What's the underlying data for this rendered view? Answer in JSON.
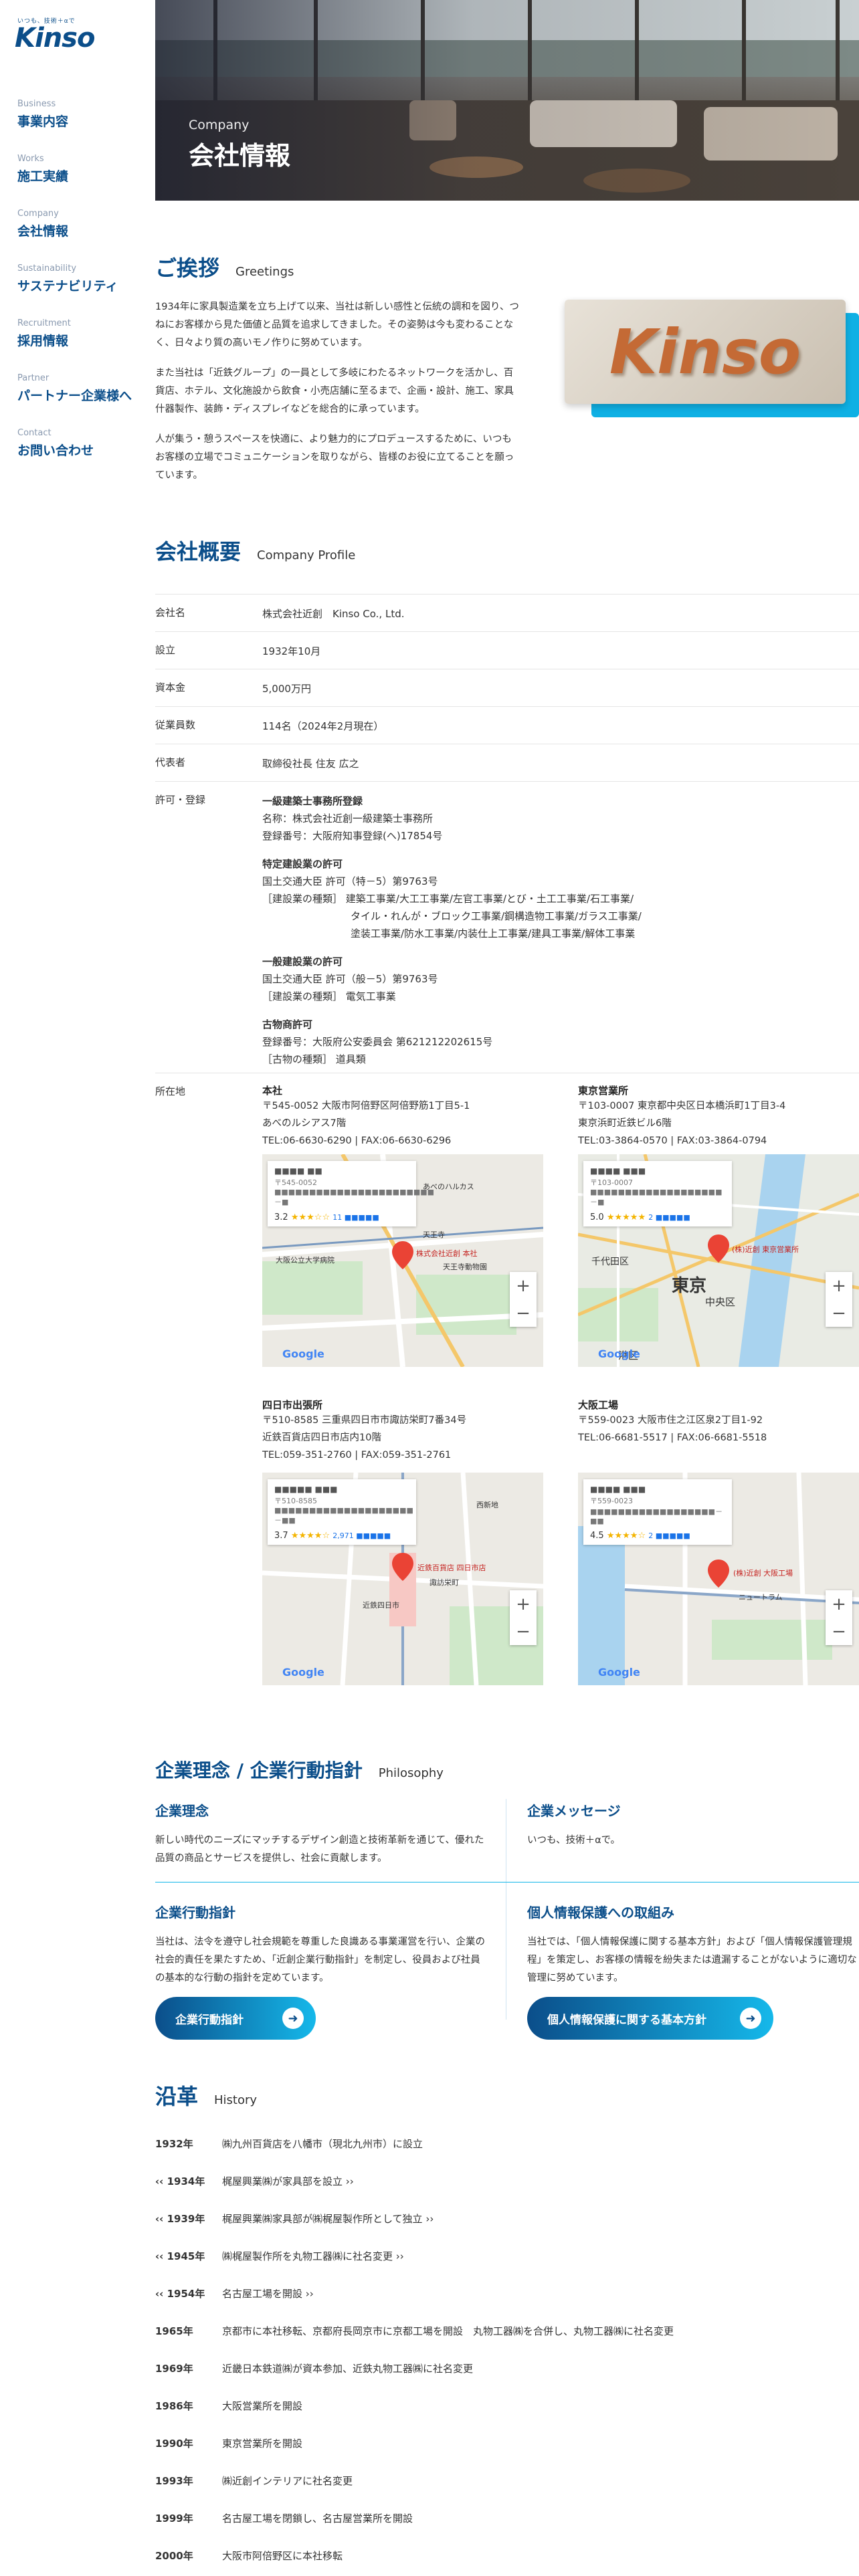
{
  "brand": {
    "tagline": "いつも、技術＋αで",
    "logo_text": "Kinso"
  },
  "nav": [
    {
      "en": "Business",
      "jp": "事業内容"
    },
    {
      "en": "Works",
      "jp": "施工実績"
    },
    {
      "en": "Company",
      "jp": "会社情報"
    },
    {
      "en": "Sustainability",
      "jp": "サステナビリティ"
    },
    {
      "en": "Recruitment",
      "jp": "採用情報"
    },
    {
      "en": "Partner",
      "jp": "パートナー企業様へ"
    },
    {
      "en": "Contact",
      "jp": "お問い合わせ"
    }
  ],
  "hero": {
    "en": "Company",
    "jp": "会社情報"
  },
  "greetings": {
    "jp": "ご挨拶",
    "en": "Greetings",
    "paragraphs": [
      "1934年に家具製造業を立ち上げて以来、当社は新しい感性と伝統の調和を図り、つねにお客様から見た価値と品質を追求してきました。その姿勢は今も変わることなく、日々より質の高いモノ作りに努めています。",
      "また当社は「近鉄グループ」の一員として多岐にわたるネットワークを活かし、百貨店、ホテル、文化施設から飲食・小売店舗に至るまで、企画・設計、施工、家具什器製作、装飾・ディスプレイなどを総合的に承っています。",
      "人が集う・憩うスペースを快適に、より魅力的にプロデュースするために、いつもお客様の立場でコミュニケーションを取りながら、皆様のお役に立てることを願っています。"
    ],
    "sign_text": "Kinso"
  },
  "profile": {
    "jp": "会社概要",
    "en": "Company Profile",
    "rows": [
      {
        "k": "会社名",
        "v": "株式会社近創　Kinso Co., Ltd."
      },
      {
        "k": "設立",
        "v": "1932年10月"
      },
      {
        "k": "資本金",
        "v": "5,000万円"
      },
      {
        "k": "従業員数",
        "v": "114名（2024年2月現在）"
      },
      {
        "k": "代表者",
        "v": "取締役社長 住友 広之"
      }
    ],
    "license_label": "許可・登録",
    "licenses": [
      {
        "h": "一級建築士事務所登録",
        "lines": [
          "名称：株式会社近創一級建築士事務所",
          "登録番号：大阪府知事登録(ヘ)17854号"
        ]
      },
      {
        "h": "特定建設業の許可",
        "lines": [
          "国土交通大臣 許可（特－5）第9763号",
          "［建設業の種類］ 建築工事業/大工工事業/左官工事業/とび・土工工事業/石工事業/",
          "タイル・れんが・ブロック工事業/鋼構造物工事業/ガラス工事業/",
          "塗装工事業/防水工事業/内装仕上工事業/建具工事業/解体工事業"
        ]
      },
      {
        "h": "一般建設業の許可",
        "lines": [
          "国土交通大臣 許可（般－5）第9763号",
          "［建設業の種類］ 電気工事業"
        ]
      },
      {
        "h": "古物商許可",
        "lines": [
          "登録番号：大阪府公安委員会 第621212202615号",
          "［古物の種類］ 道具類"
        ]
      }
    ],
    "location_label": "所在地",
    "offices": [
      {
        "name": "本社",
        "lines": [
          "〒545-0052 大阪市阿倍野区阿倍野筋1丁目5-1",
          "あべのルシアス7階",
          "TEL:06-6630-6290 | FAX:06-6630-6296"
        ],
        "card_title": "■■■■ ■■",
        "card_addr": "〒545-0052 ■■■■■■■■■■■■■■■■■■■■■■■－■",
        "rating": "3.2",
        "stars": "★★★☆☆",
        "reviews": "11 ■■■■■",
        "labels": [
          "あべのハルカス",
          "大阪公立大学病院",
          "天王寺動物園",
          "天王寺",
          "株式会社近創 本社"
        ]
      },
      {
        "name": "東京営業所",
        "lines": [
          "〒103-0007 東京都中央区日本橋浜町1丁目3-4",
          "東京浜町近鉄ビル6階",
          "TEL:03-3864-0570 | FAX:03-3864-0794"
        ],
        "card_title": "■■■■ ■■■",
        "card_addr": "〒103-0007 ■■■■■■■■■■■■■■■■■■■－■",
        "rating": "5.0",
        "stars": "★★★★★",
        "reviews": "2 ■■■■■",
        "labels": [
          "千代田区",
          "東京",
          "中央区",
          "港区",
          "(株)近創 東京営業所"
        ]
      },
      {
        "name": "四日市出張所",
        "lines": [
          "〒510-8585 三重県四日市市諏訪栄町7番34号",
          "近鉄百貨店四日市店内10階",
          "TEL:059-351-2760 | FAX:059-351-2761"
        ],
        "card_title": "■■■■■ ■■■",
        "card_addr": "〒510-8585 ■■■■■■■■■■■■■■■■■■■■－■■",
        "rating": "3.7",
        "stars": "★★★★☆",
        "reviews": "2,971 ■■■■■",
        "labels": [
          "近鉄四日市",
          "近鉄百貨店 四日市店",
          "諏訪栄町",
          "西新地"
        ]
      },
      {
        "name": "大阪工場",
        "lines": [
          "〒559-0023 大阪市住之江区泉2丁目1-92",
          "TEL:06-6681-5517 | FAX:06-6681-5518"
        ],
        "card_title": "■■■■ ■■■",
        "card_addr": "〒559-0023 ■■■■■■■■■■■■■■■■■■－■■",
        "rating": "4.5",
        "stars": "★★★★☆",
        "reviews": "2 ■■■■■",
        "labels": [
          "(株)近創 大阪工場",
          "ニュートラム"
        ]
      }
    ]
  },
  "philosophy": {
    "jp": "企業理念 / 企業行動指針",
    "en": "Philosophy",
    "boxes": [
      {
        "h": "企業理念",
        "p": "新しい時代のニーズにマッチするデザイン創造と技術革新を通じて、優れた品質の商品とサービスを提供し、社会に貢献します。"
      },
      {
        "h": "企業メッセージ",
        "p": "いつも、技術＋αで。"
      },
      {
        "h": "企業行動指針",
        "p": "当社は、法令を遵守し社会規範を尊重した良識ある事業運営を行い、企業の社会的責任を果たすため、「近創企業行動指針」を制定し、役員および社員の基本的な行動の指針を定めています。"
      },
      {
        "h": "個人情報保護への取組み",
        "p": "当社では、「個人情報保護に関する基本方針」および「個人情報保護管理規程」を策定し、お客様の情報を紛失または遺漏することがないように適切な管理に努めています。"
      }
    ],
    "btn1": "企業行動指針",
    "btn2": "個人情報保護に関する基本方針"
  },
  "history": {
    "jp": "沿革",
    "en": "History",
    "rows": [
      {
        "y": "1932年",
        "t": "㈱九州百貨店を八幡市（現北九州市）に設立"
      },
      {
        "y": "‹‹ 1934年",
        "t": "梶屋興業㈱が家具部を設立 ››"
      },
      {
        "y": "‹‹ 1939年",
        "t": "梶屋興業㈱家具部が㈱梶屋製作所として独立 ››"
      },
      {
        "y": "‹‹ 1945年",
        "t": "㈱梶屋製作所を丸物工器㈱に社名変更 ››"
      },
      {
        "y": "‹‹ 1954年",
        "t": "名古屋工場を開設 ››"
      },
      {
        "y": "1965年",
        "t": "京都市に本社移転、京都府長岡京市に京都工場を開設　丸物工器㈱を合併し、丸物工器㈱に社名変更"
      },
      {
        "y": "1969年",
        "t": "近畿日本鉄道㈱が資本参加、近鉄丸物工器㈱に社名変更"
      },
      {
        "y": "1986年",
        "t": "大阪営業所を開設"
      },
      {
        "y": "1990年",
        "t": "東京営業所を開設"
      },
      {
        "y": "1993年",
        "t": "㈱近創インテリアに社名変更"
      },
      {
        "y": "1999年",
        "t": "名古屋工場を閉鎖し、名古屋営業所を開設"
      },
      {
        "y": "2000年",
        "t": "大阪市阿倍野区に本社移転"
      }
    ]
  },
  "colors": {
    "brand": "#0b4e8a",
    "accent": "#15b8ea"
  }
}
